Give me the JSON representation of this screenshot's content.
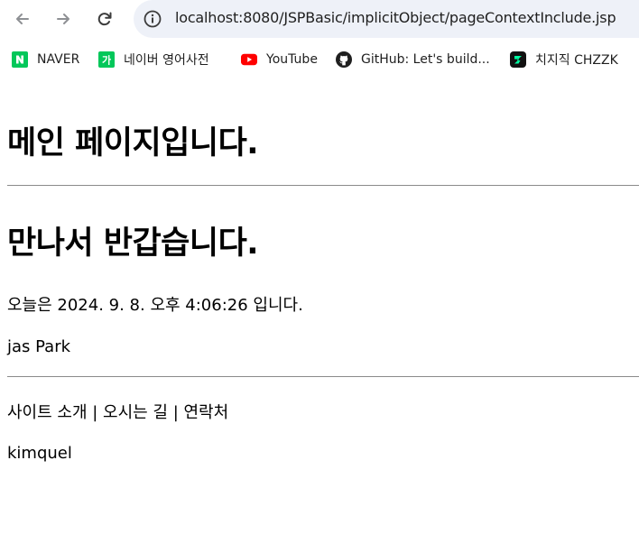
{
  "browser": {
    "url": "localhost:8080/JSPBasic/implicitObject/pageContextInclude.jsp",
    "nav": {
      "back_icon": "arrow-left-icon",
      "forward_icon": "arrow-right-icon",
      "reload_icon": "reload-icon",
      "site_info_icon": "info-circle-icon"
    }
  },
  "bookmarks": [
    {
      "label": "NAVER",
      "icon": "naver-n-icon",
      "color": "#03c75a"
    },
    {
      "label": "네이버 영어사전",
      "icon": "naver-dict-icon",
      "color": "#03c75a"
    },
    {
      "label": "YouTube",
      "icon": "youtube-icon",
      "color": "#ff0000"
    },
    {
      "label": "GitHub: Let's build...",
      "icon": "github-icon",
      "color": "#1f1f1f"
    },
    {
      "label": "치지직 CHZZK",
      "icon": "chzzk-icon",
      "color": "#00ffa3"
    }
  ],
  "page": {
    "main_heading": "메인 페이지입니다.",
    "greeting_heading": "만나서 반갑습니다.",
    "today_text": "오늘은 2024. 9. 8. 오후 4:06:26 입니다.",
    "user_name": "jas Park",
    "footer_links": "사이트 소개 | 오시는 길 | 연락처",
    "footer_author": "kimquel"
  }
}
